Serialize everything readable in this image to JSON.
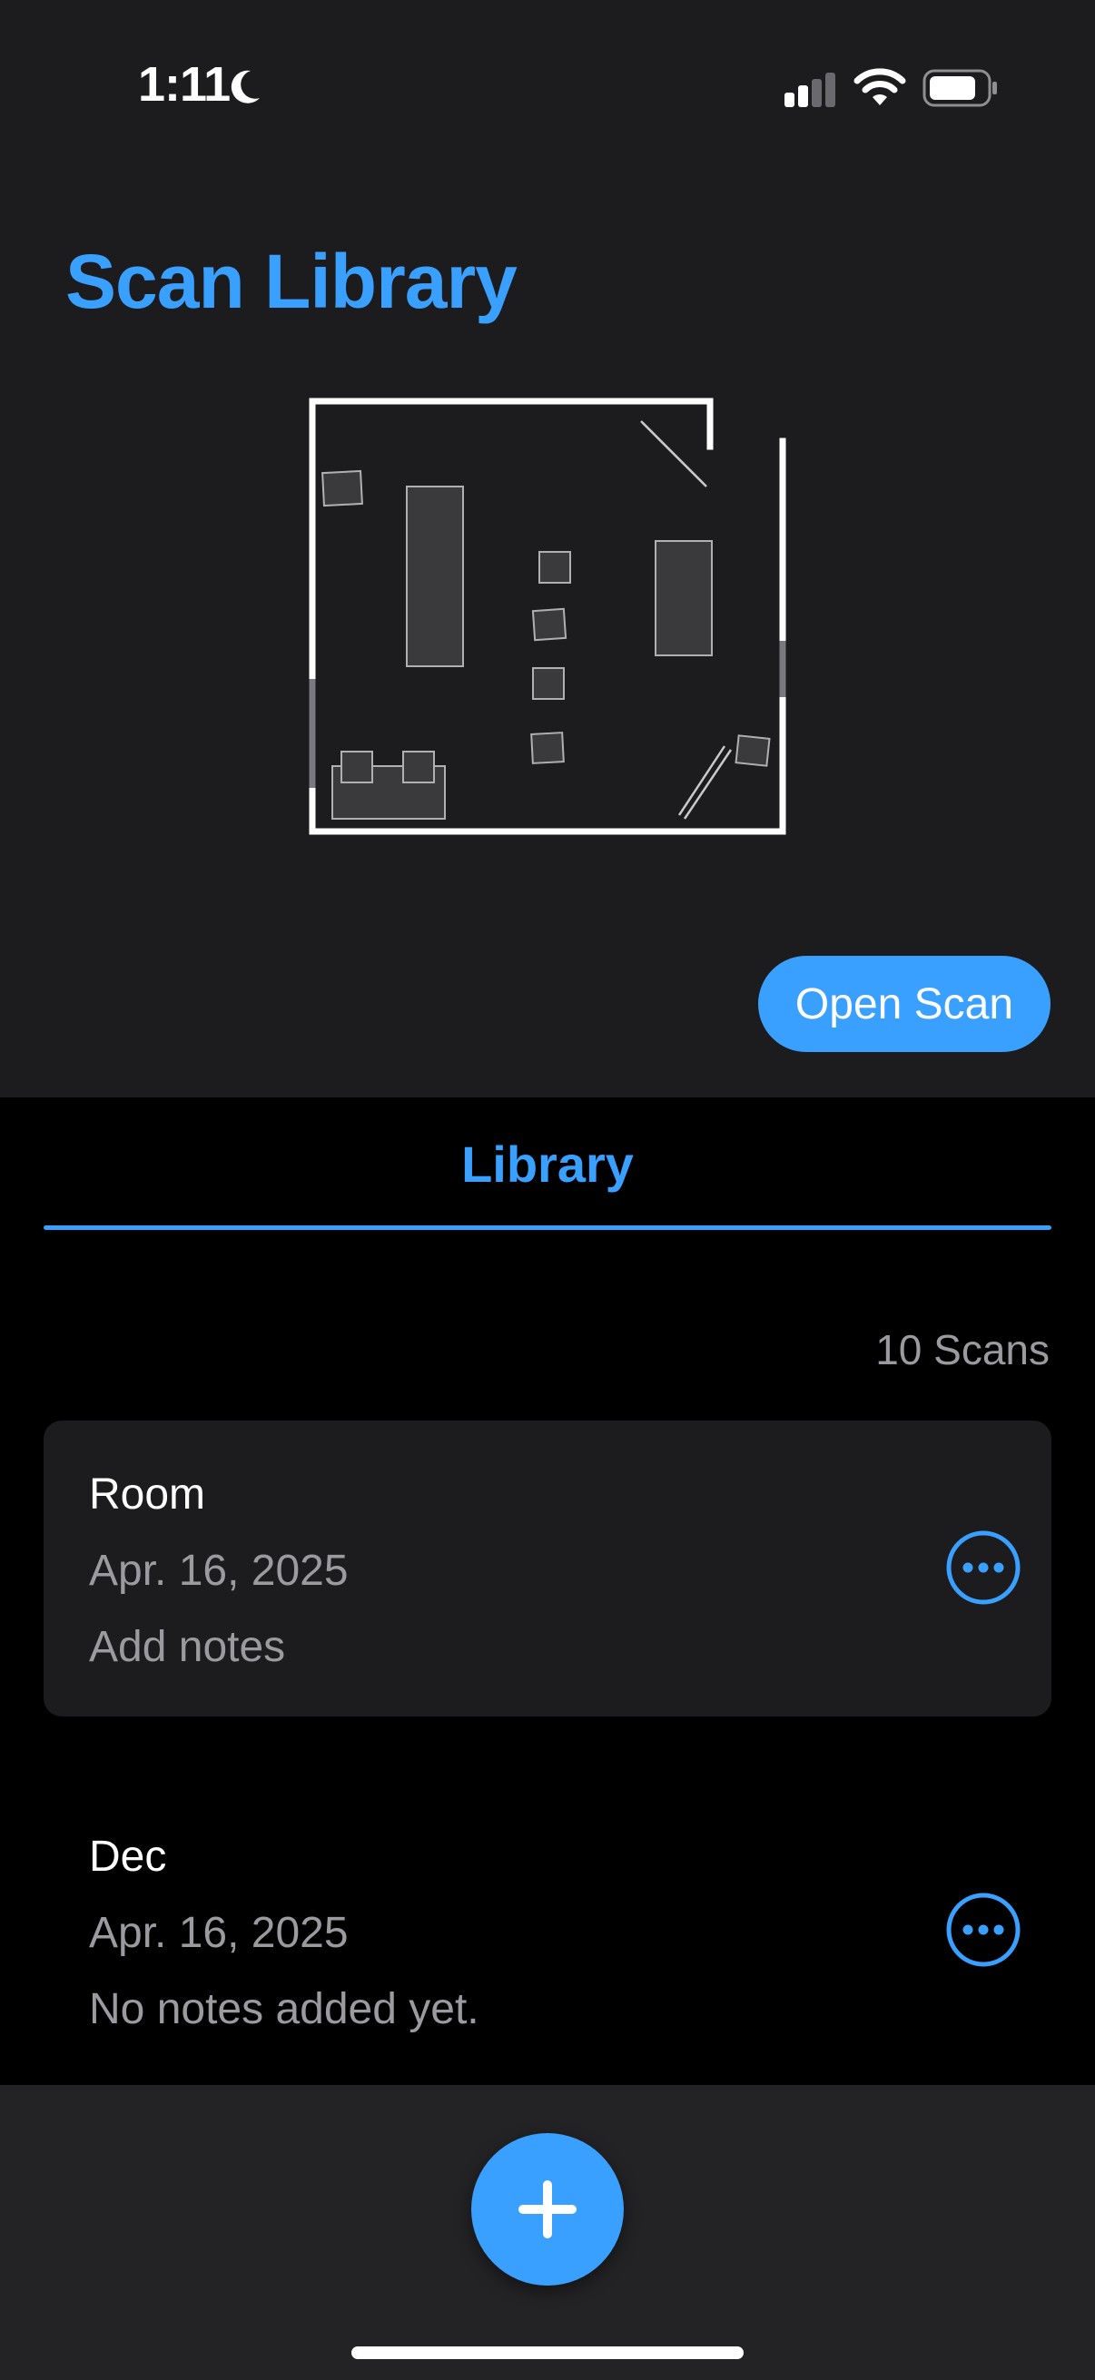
{
  "status_bar": {
    "time": "1:11"
  },
  "header": {
    "title": "Scan Library"
  },
  "preview": {
    "open_button": "Open Scan"
  },
  "tabs": [
    {
      "label": "Library",
      "selected": true
    }
  ],
  "library": {
    "count_label": "10 Scans",
    "items": [
      {
        "name": "Room",
        "date": "Apr. 16, 2025",
        "notes": "Add notes",
        "selected": true
      },
      {
        "name": "Dec",
        "date": "Apr. 16, 2025",
        "notes": "No notes added yet.",
        "selected": false
      }
    ]
  },
  "icons": {
    "moon": "moon-icon",
    "signal": "cellular-signal-icon",
    "wifi": "wifi-icon",
    "battery": "battery-icon",
    "more": "more-options-icon",
    "add": "plus-icon"
  },
  "colors": {
    "accent": "#3aa0ff",
    "background": "#000000",
    "surface": "#1c1c1e",
    "secondary_text": "#9a9a9f"
  }
}
